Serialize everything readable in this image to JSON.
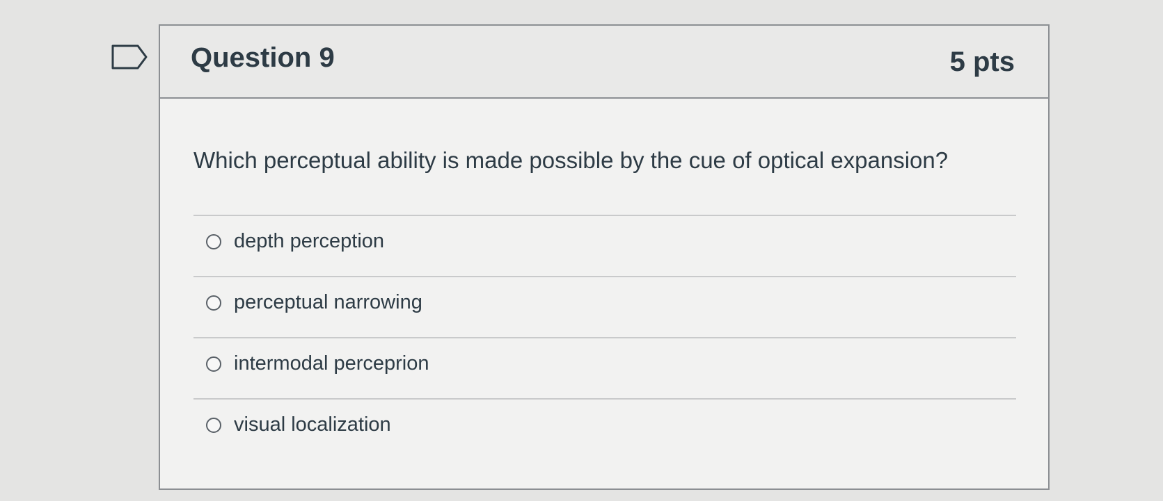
{
  "question": {
    "title": "Question 9",
    "points": "5 pts",
    "text": "Which perceptual ability is made possible by the cue of optical expansion?",
    "answers": [
      {
        "label": "depth perception",
        "selected": false
      },
      {
        "label": "perceptual narrowing",
        "selected": false
      },
      {
        "label": "intermodal perceprion",
        "selected": false
      },
      {
        "label": "visual localization",
        "selected": false
      }
    ]
  },
  "icons": {
    "bookmark": "bookmark-flag-icon",
    "radio": "radio-button-icon"
  },
  "colors": {
    "text": "#2d3b45",
    "border": "#8c8f93",
    "header_bg": "#e9e9e8",
    "card_bg": "#f2f2f1"
  }
}
